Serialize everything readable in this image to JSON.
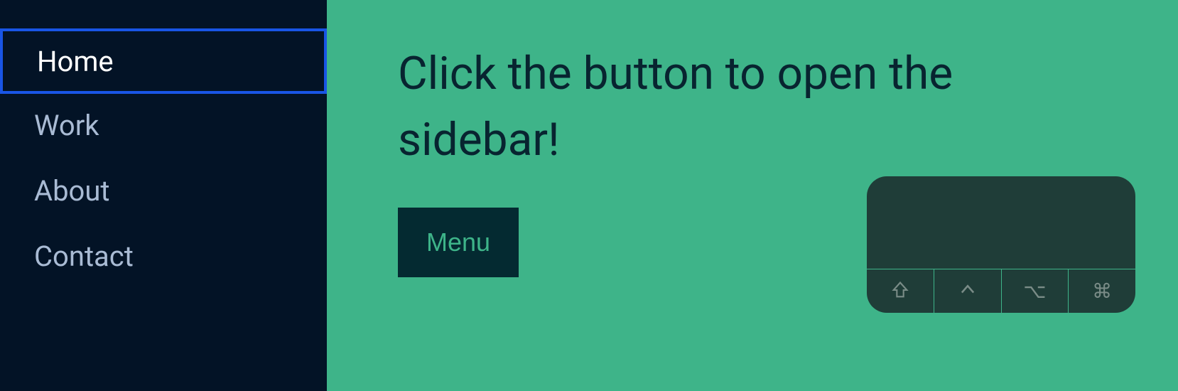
{
  "sidebar": {
    "items": [
      {
        "label": "Home",
        "active": true
      },
      {
        "label": "Work",
        "active": false
      },
      {
        "label": "About",
        "active": false
      },
      {
        "label": "Contact",
        "active": false
      }
    ]
  },
  "main": {
    "headline": "Click the button to open the sidebar!",
    "menu_button_label": "Menu"
  },
  "keyboard": {
    "keys": [
      "shift",
      "control",
      "option",
      "command"
    ]
  },
  "colors": {
    "sidebar_bg": "#031326",
    "main_bg": "#3eb489",
    "headline_color": "#082430",
    "button_bg": "#042a31",
    "button_text": "#3eb489",
    "active_border": "#1955e5",
    "sidebar_text": "#a9bbd4",
    "sidebar_active_text": "#ffffff",
    "panel_bg": "#1f3d38"
  }
}
